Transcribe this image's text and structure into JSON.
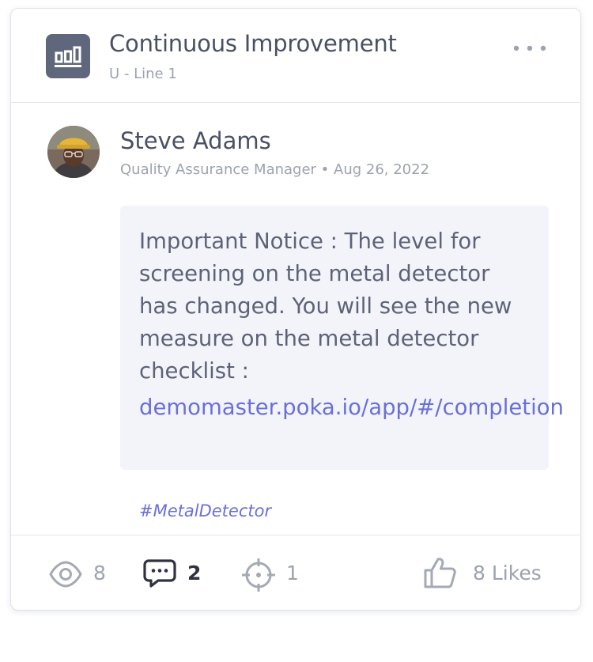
{
  "group": {
    "title": "Continuous Improvement",
    "subtitle": "U - Line 1",
    "icon": "bar-chart-icon"
  },
  "post": {
    "author": "Steve Adams",
    "meta": "Quality Assurance Manager • Aug 26, 2022",
    "avatar": "avatar-photo",
    "message": "Important Notice : The level for screening on the metal detector has changed. You will see the new measure on the metal detector checklist :",
    "link": "demomaster.poka.io/app/#/completion",
    "hashtag": "#MetalDetector"
  },
  "stats": {
    "views": "8",
    "comments": "2",
    "targets": "1",
    "likes": "8 Likes"
  },
  "colors": {
    "accent": "#6a6fd8",
    "text_primary": "#4a5064",
    "text_secondary": "#9ca2b0",
    "message_bg": "#f3f4fa",
    "icon_bg": "#5f677d"
  }
}
